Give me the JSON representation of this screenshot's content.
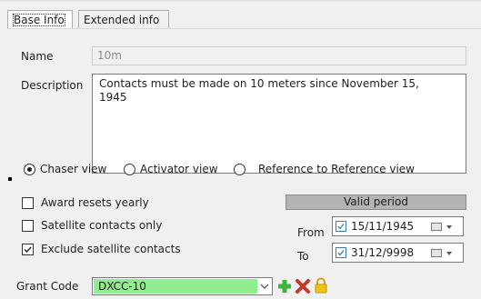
{
  "tabs": [
    {
      "label": "Base Info",
      "active": true
    },
    {
      "label": "Extended info",
      "active": false
    }
  ],
  "fields": {
    "name_label": "Name",
    "name_value": "10m",
    "description_label": "Description",
    "description_value": "Contacts must be made on 10 meters since November 15,\n1945"
  },
  "view_options": {
    "options": [
      "Chaser view",
      "Activator view",
      "Reference to Reference view"
    ],
    "selected": "Chaser view"
  },
  "checkboxes": [
    {
      "label": "Award resets yearly",
      "checked": false
    },
    {
      "label": "Satellite contacts only",
      "checked": false
    },
    {
      "label": "Exclude satellite contacts",
      "checked": true
    }
  ],
  "valid_period": {
    "title": "Valid period",
    "from_label": "From",
    "from_value": "15/11/1945",
    "from_checked": true,
    "to_label": "To",
    "to_value": "31/12/9998",
    "to_checked": true
  },
  "grant_code": {
    "label": "Grant Code",
    "value": "DXCC-10",
    "highlight_color": "#90ee90"
  },
  "icons": [
    "add-icon",
    "delete-icon",
    "lock-icon",
    "calendar-icon",
    "chevron-down-icon",
    "arrow-indicator-icon"
  ],
  "colors": {
    "background": "#f0f0f0",
    "highlight": "#90ee90",
    "add": "#3db33d",
    "delete": "#c0392b",
    "lock": "#f1c40f",
    "valid_bar": "#b4b4b4"
  }
}
